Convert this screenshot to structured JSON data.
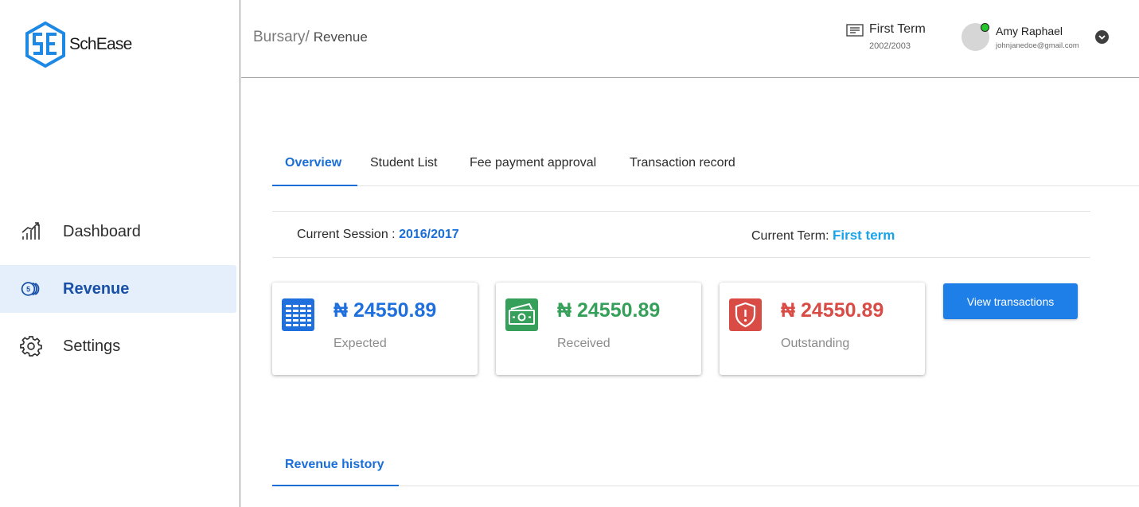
{
  "app": {
    "name": "SchEase"
  },
  "colors": {
    "accent": "#1a6ed8",
    "expected": "#1f6fdd",
    "received": "#36a05a",
    "outstanding": "#d94b45",
    "active_bg": "#e5eefb"
  },
  "sidebar": {
    "items": [
      {
        "label": "Dashboard",
        "icon": "chart-bars-icon"
      },
      {
        "label": "Revenue",
        "icon": "coins-icon",
        "active": true
      },
      {
        "label": "Settings",
        "icon": "gear-icon"
      }
    ]
  },
  "header": {
    "breadcrumb_root": "Bursary/",
    "breadcrumb_current": "Revenue",
    "term_label": "First Term",
    "term_session": "2002/2003",
    "user_name": "Amy Raphael",
    "user_email": "johnjanedoe@gmail.com"
  },
  "tabs": [
    {
      "label": "Overview",
      "active": true
    },
    {
      "label": "Student List"
    },
    {
      "label": "Fee payment approval"
    },
    {
      "label": "Transaction record"
    }
  ],
  "session": {
    "session_label": "Current Session :",
    "session_value": "2016/2017",
    "term_label": "Current Term:",
    "term_value": "First term"
  },
  "cards": [
    {
      "value": "₦ 24550.89",
      "caption": "Expected",
      "icon": "table-chart-icon"
    },
    {
      "value": "₦ 24550.89",
      "caption": "Received",
      "icon": "cash-icon"
    },
    {
      "value": "₦ 24550.89",
      "caption": "Outstanding",
      "icon": "shield-alert-icon"
    }
  ],
  "actions": {
    "view_transactions": "View transactions"
  },
  "history": {
    "tab_label": "Revenue history"
  }
}
